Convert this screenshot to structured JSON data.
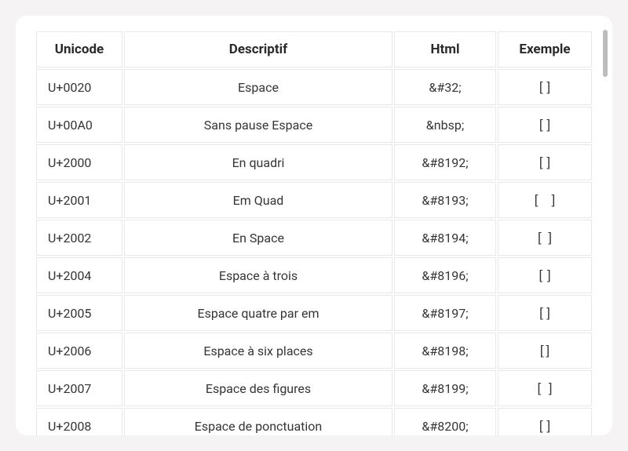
{
  "table": {
    "headers": {
      "unicode": "Unicode",
      "description": "Descriptif",
      "html": "Html",
      "example": "Exemple"
    },
    "rows": [
      {
        "unicode": "U+0020",
        "description": "Espace",
        "html": "&#32;",
        "example": "[ ]"
      },
      {
        "unicode": "U+00A0",
        "description": "Sans pause Espace",
        "html": "&nbsp;",
        "example": "[ ]"
      },
      {
        "unicode": "U+2000",
        "description": "En quadri",
        "html": "&#8192;",
        "example": "[ ]"
      },
      {
        "unicode": "U+2001",
        "description": "Em Quad",
        "html": "&#8193;",
        "example": "[ ]"
      },
      {
        "unicode": "U+2002",
        "description": "En Space",
        "html": "&#8194;",
        "example": "[ ]"
      },
      {
        "unicode": "U+2004",
        "description": "Espace à trois",
        "html": "&#8196;",
        "example": "[ ]"
      },
      {
        "unicode": "U+2005",
        "description": "Espace quatre par em",
        "html": "&#8197;",
        "example": "[ ]"
      },
      {
        "unicode": "U+2006",
        "description": "Espace à six places",
        "html": "&#8198;",
        "example": "[ ]"
      },
      {
        "unicode": "U+2007",
        "description": "Espace des figures",
        "html": "&#8199;",
        "example": "[ ]"
      },
      {
        "unicode": "U+2008",
        "description": "Espace de ponctuation",
        "html": "&#8200;",
        "example": "[ ]"
      }
    ]
  }
}
